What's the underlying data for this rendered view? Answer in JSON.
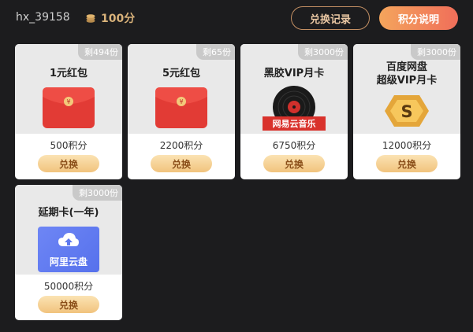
{
  "header": {
    "username": "hx_39158",
    "points_value": "100分",
    "coin_icon": "coin-stack-icon",
    "record_label": "兑换记录",
    "explain_label": "积分说明"
  },
  "rewards": [
    {
      "title": "1元红包",
      "remaining": "剩494份",
      "cost": "500积分",
      "button": "兑换",
      "icon": "red-envelope-icon"
    },
    {
      "title": "5元红包",
      "remaining": "剩65份",
      "cost": "2200积分",
      "button": "兑换",
      "icon": "red-envelope-icon"
    },
    {
      "title": "黑胶VIP月卡",
      "remaining": "剩3000份",
      "cost": "6750积分",
      "button": "兑换",
      "icon": "vinyl-record-icon",
      "badge": "网易云音乐"
    },
    {
      "title_line1": "百度网盘",
      "title_line2": "超级VIP月卡",
      "remaining": "剩3000份",
      "cost": "12000积分",
      "button": "兑换",
      "icon": "baidu-svip-icon"
    },
    {
      "title": "延期卡(一年)",
      "remaining": "剩3000份",
      "cost": "50000积分",
      "button": "兑换",
      "icon": "aliyun-drive-icon",
      "badge": "阿里云盘"
    }
  ],
  "colors": {
    "background": "#1c1c1e",
    "accent_start": "#f4a55c",
    "accent_end": "#f06e5a",
    "red_packet": "#e23b35"
  }
}
